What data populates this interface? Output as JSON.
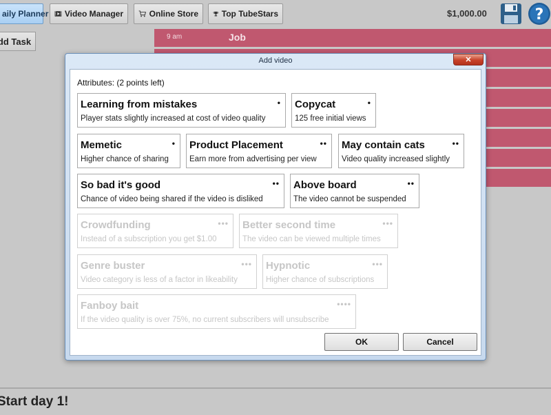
{
  "toolbar": {
    "tabs": [
      {
        "label": "aily Planner",
        "icon": "calendar-icon"
      },
      {
        "label": "Video Manager",
        "icon": "film-icon"
      },
      {
        "label": "Online Store",
        "icon": "cart-icon"
      },
      {
        "label": "Top TubeStars",
        "icon": "trophy-icon"
      }
    ],
    "money": "$1,000.00"
  },
  "planner": {
    "add_task_label": "dd Task",
    "slots": [
      {
        "time": "9 am",
        "task": "Job"
      },
      {
        "time": "",
        "task": ""
      },
      {
        "time": "",
        "task": ""
      },
      {
        "time": "",
        "task": ""
      },
      {
        "time": "",
        "task": ""
      },
      {
        "time": "",
        "task": ""
      },
      {
        "time": "",
        "task": ""
      },
      {
        "time": "",
        "task": ""
      }
    ],
    "start_day_label": "Start day 1!"
  },
  "dialog": {
    "title": "Add video",
    "close_label": "✕",
    "attributes_label": "Attributes: (2 points left)",
    "attributes": [
      {
        "title": "Learning from mistakes",
        "description": "Player stats slightly increased at cost of video quality",
        "cost": "•",
        "enabled": true
      },
      {
        "title": "Copycat",
        "description": "125 free initial views",
        "cost": "•",
        "enabled": true
      },
      {
        "title": "Memetic",
        "description": "Higher chance of sharing",
        "cost": "•",
        "enabled": true
      },
      {
        "title": "Product Placement",
        "description": "Earn more from advertising per view",
        "cost": "••",
        "enabled": true
      },
      {
        "title": "May contain cats",
        "description": "Video quality increased slightly",
        "cost": "••",
        "enabled": true
      },
      {
        "title": "So bad it's good",
        "description": "Chance of video being shared if the video is disliked",
        "cost": "••",
        "enabled": true
      },
      {
        "title": "Above board",
        "description": "The video cannot be suspended",
        "cost": "••",
        "enabled": true
      },
      {
        "title": "Crowdfunding",
        "description": "Instead of a subscription you get $1.00",
        "cost": "•••",
        "enabled": false
      },
      {
        "title": "Better second time",
        "description": "The video can be viewed multiple times",
        "cost": "•••",
        "enabled": false
      },
      {
        "title": "Genre buster",
        "description": "Video category is less of a factor in likeability",
        "cost": "•••",
        "enabled": false
      },
      {
        "title": "Hypnotic",
        "description": "Higher chance of subscriptions",
        "cost": "•••",
        "enabled": false
      },
      {
        "title": "Fanboy bait",
        "description": "If the video quality is over 75%, no current subscribers will unsubscribe",
        "cost": "••••",
        "enabled": false
      }
    ],
    "ok_label": "OK",
    "cancel_label": "Cancel"
  }
}
